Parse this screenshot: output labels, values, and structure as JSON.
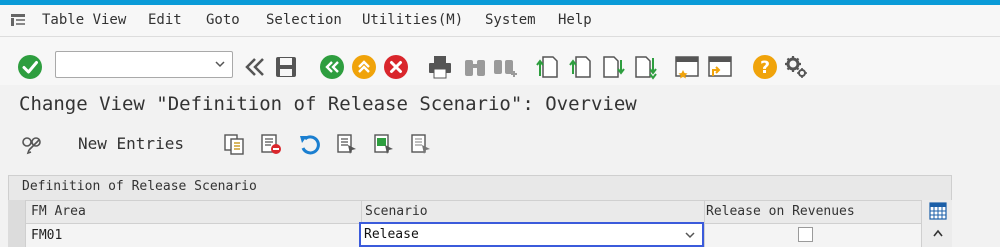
{
  "menu": {
    "items": [
      "Table View",
      "Edit",
      "Goto",
      "Selection",
      "Utilities(M)",
      "System",
      "Help"
    ]
  },
  "toolbar": {
    "command_field_value": "",
    "icons": [
      "enter-icon",
      "back-double-icon",
      "save-icon",
      "back-icon",
      "exit-icon",
      "cancel-icon",
      "print-icon",
      "find-icon",
      "find-next-icon",
      "first-page-icon",
      "previous-page-icon",
      "next-page-icon",
      "last-page-icon",
      "create-session-icon",
      "create-shortcut-icon",
      "help-icon",
      "customize-layout-icon"
    ]
  },
  "page": {
    "title": "Change View \"Definition of Release Scenario\": Overview"
  },
  "app_toolbar": {
    "new_entries_label": "New Entries",
    "icons": [
      "display-change-icon",
      "copy-as-icon",
      "delete-icon",
      "undo-icon",
      "select-all-icon",
      "select-block-icon",
      "deselect-all-icon"
    ]
  },
  "table": {
    "title": "Definition of Release Scenario",
    "columns": [
      "FM Area",
      "Scenario",
      "Release on Revenues"
    ],
    "rows": [
      {
        "fm_area": "FM01",
        "scenario": "Release",
        "release_on_revenues": false
      }
    ]
  },
  "colors": {
    "accent": "#0a9bd8",
    "enter_green": "#2e9e3f",
    "back_green": "#2e9e3f",
    "exit_orange": "#f0a30a",
    "cancel_red": "#d9262c",
    "help_orange": "#f0a30a",
    "focus_blue": "#3b5bdb"
  }
}
